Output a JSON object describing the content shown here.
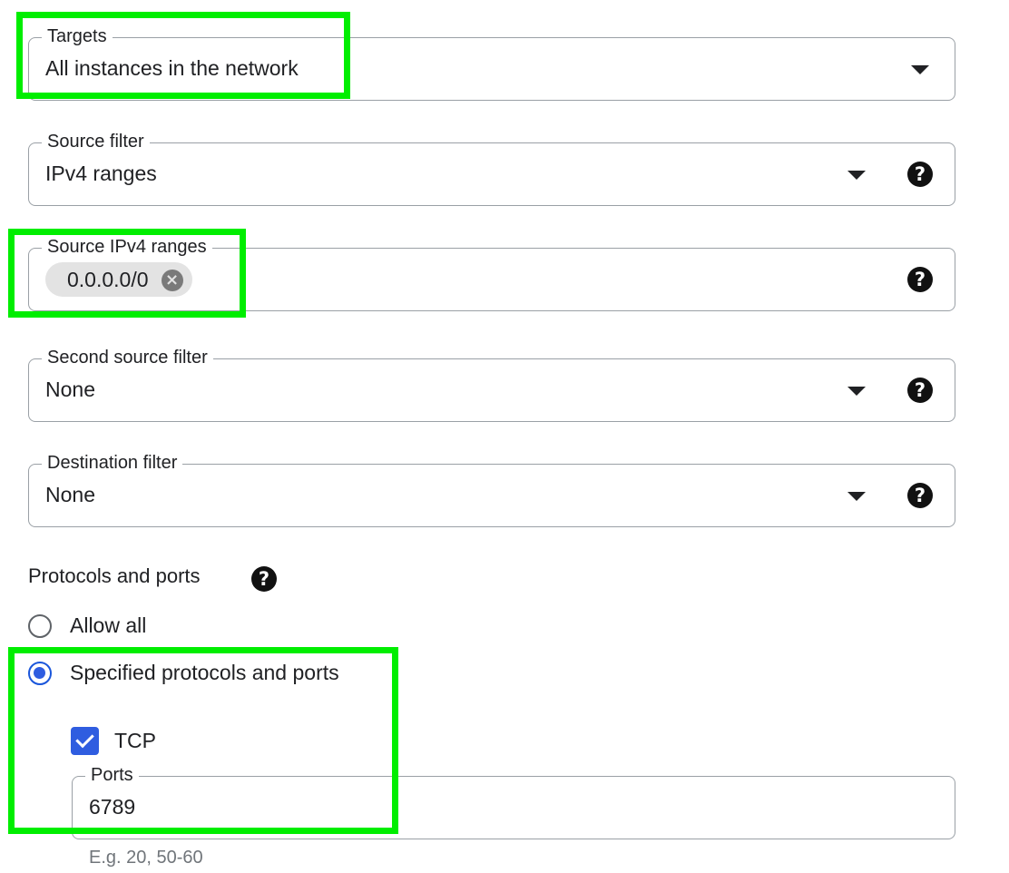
{
  "targets": {
    "label": "Targets",
    "value": "All instances in the network"
  },
  "source_filter": {
    "label": "Source filter",
    "value": "IPv4 ranges"
  },
  "source_ipv4_ranges": {
    "label": "Source IPv4 ranges",
    "chips": [
      "0.0.0.0/0"
    ]
  },
  "second_source_filter": {
    "label": "Second source filter",
    "value": "None"
  },
  "destination_filter": {
    "label": "Destination filter",
    "value": "None"
  },
  "protocols": {
    "title": "Protocols and ports",
    "options": [
      {
        "label": "Allow all",
        "selected": false
      },
      {
        "label": "Specified protocols and ports",
        "selected": true
      }
    ],
    "tcp": {
      "label": "TCP",
      "checked": true
    },
    "ports": {
      "label": "Ports",
      "value": "6789",
      "hint": "E.g. 20, 50-60"
    }
  },
  "icons": {
    "help": "?",
    "chip_remove": "×"
  },
  "colors": {
    "accent": "#2f5de0",
    "highlight": "#00ee00"
  }
}
